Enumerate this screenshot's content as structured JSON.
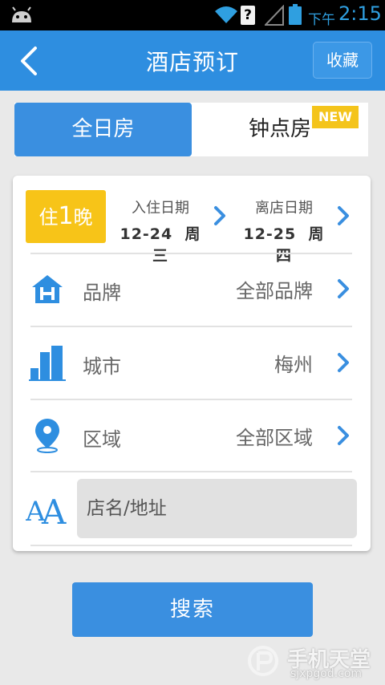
{
  "status_bar": {
    "ampm": "下午",
    "time": "2:15",
    "unknown_icon": "?"
  },
  "header": {
    "title": "酒店预订",
    "favorite_label": "收藏"
  },
  "tabs": [
    {
      "label": "全日房",
      "selected": true
    },
    {
      "label": "钟点房",
      "badge": "NEW",
      "selected": false
    }
  ],
  "stay": {
    "prefix": "住",
    "nights": "1",
    "suffix": "晚"
  },
  "checkin": {
    "label": "入住日期",
    "date": "12-24",
    "weekday": "周三"
  },
  "checkout": {
    "label": "离店日期",
    "date": "12-25",
    "weekday": "周四"
  },
  "rows": {
    "brand": {
      "label": "品牌",
      "value": "全部品牌",
      "icon": "hotel-building-icon"
    },
    "city": {
      "label": "城市",
      "value": "梅州",
      "icon": "city-buildings-icon"
    },
    "district": {
      "label": "区域",
      "value": "全部区域",
      "icon": "map-pin-icon"
    }
  },
  "search": {
    "placeholder": "店名/地址",
    "icon": "font-aa-icon",
    "button_label": "搜索"
  },
  "watermark": {
    "text": "手机天堂",
    "url": "sjxpgod.com"
  },
  "colors": {
    "primary": "#2e8ee0",
    "accent": "#f7c418",
    "text": "#666666"
  }
}
